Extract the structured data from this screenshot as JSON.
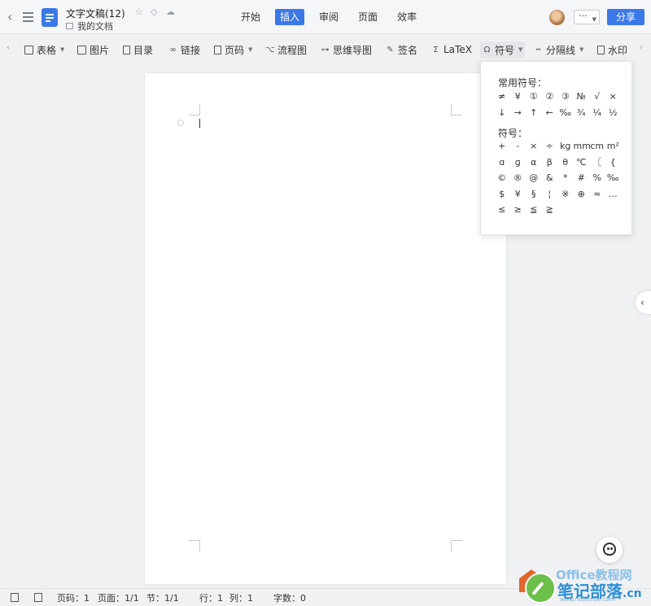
{
  "titlebar": {
    "doc_title": "文字文稿(12)",
    "folder": "我的文档",
    "icons": [
      "back-icon",
      "menu-icon",
      "document-icon",
      "star-icon",
      "tag-icon",
      "cloud-icon"
    ]
  },
  "menu": {
    "tabs": [
      {
        "label": "开始",
        "active": false
      },
      {
        "label": "插入",
        "active": true
      },
      {
        "label": "审阅",
        "active": false
      },
      {
        "label": "页面",
        "active": false
      },
      {
        "label": "效率",
        "active": false
      }
    ]
  },
  "header_right": {
    "more_label": "···",
    "share_label": "分享"
  },
  "toolbar": {
    "table": "表格",
    "image": "图片",
    "toc": "目录",
    "link": "链接",
    "page_number": "页码",
    "flowchart": "流程图",
    "mindmap": "思维导图",
    "signature": "签名",
    "latex": "LaTeX",
    "symbol": "符号",
    "divider": "分隔线",
    "watermark": "水印"
  },
  "symbol_panel": {
    "common_heading": "常用符号：",
    "common": [
      "≠",
      "¥",
      "①",
      "②",
      "③",
      "№",
      "√",
      "×",
      "↓",
      "→",
      "↑",
      "←",
      "‰",
      "¾",
      "¼",
      "½"
    ],
    "symbols_heading": "符号：",
    "symbols": [
      "+",
      "-",
      "×",
      "÷",
      "kg",
      "mm",
      "cm",
      "m²",
      "ɑ",
      "ɡ",
      "α",
      "β",
      "θ",
      "℃",
      "〖",
      "{",
      "©",
      "®",
      "@",
      "&",
      "*",
      "#",
      "%",
      "‰",
      "$",
      "¥",
      "§",
      "¦",
      "※",
      "⊕",
      "≈",
      "…",
      "≤",
      "≥",
      "≦",
      "≧"
    ]
  },
  "statusbar": {
    "page_no": "页码：1",
    "page_count": "页面：1/1",
    "section": "节：1/1",
    "row": "行：1",
    "col": "列：1",
    "words": "字数：0"
  },
  "watermark": {
    "line1": "Office教程网",
    "line2": "笔记部落",
    "line3": "www.notetribe.com",
    "line2_suffix": ".cn"
  },
  "colors": {
    "accent": "#3b78e7",
    "page_bg": "#ffffff",
    "app_bg": "#f0f1f3"
  }
}
